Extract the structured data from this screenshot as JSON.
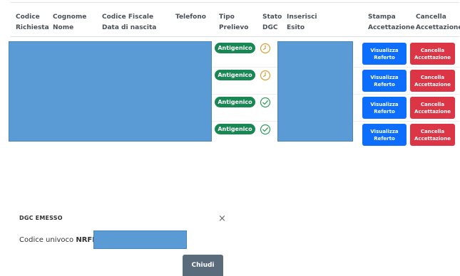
{
  "table": {
    "headers": [
      "Codice\nRichiesta",
      "Cognome\nNome",
      "Codice Fiscale\nData di nascita",
      "Telefono",
      "Tipo\nPrelievo",
      "Stato\nDGC",
      "Inserisci\nEsito",
      "Stampa\nAccettazione",
      "Cancella\nAccettazione"
    ],
    "rows": [
      {
        "tipo": "Antigenico",
        "stato": "pending-clock-icon",
        "visualizza": "Visualizza\nReferto",
        "cancella": "Cancella\nAccettazione"
      },
      {
        "tipo": "Antigenico",
        "stato": "pending-clock-icon",
        "visualizza": "Visualizza\nReferto",
        "cancella": "Cancella\nAccettazione"
      },
      {
        "tipo": "Antigenico",
        "stato": "check-circle-icon",
        "visualizza": "Visualizza\nReferto",
        "cancella": "Cancella\nAccettazione"
      },
      {
        "tipo": "Antigenico",
        "stato": "check-circle-icon",
        "visualizza": "Visualizza\nReferto",
        "cancella": "Cancella\nAccettazione"
      }
    ]
  },
  "modal": {
    "title": "DGC EMESSO",
    "close_symbol": "×",
    "label_prefix": "Codice univoco ",
    "label_bold": "NRFE:",
    "button": "Chiudi"
  },
  "colors": {
    "badge_green": "#198754",
    "button_blue": "#0d6efd",
    "button_red": "#dc3545",
    "redaction": "#5b9bd5",
    "clock_orange": "#d9a030",
    "check_green": "#2e9e5b",
    "chiudi_gray": "#5a6b7b"
  }
}
